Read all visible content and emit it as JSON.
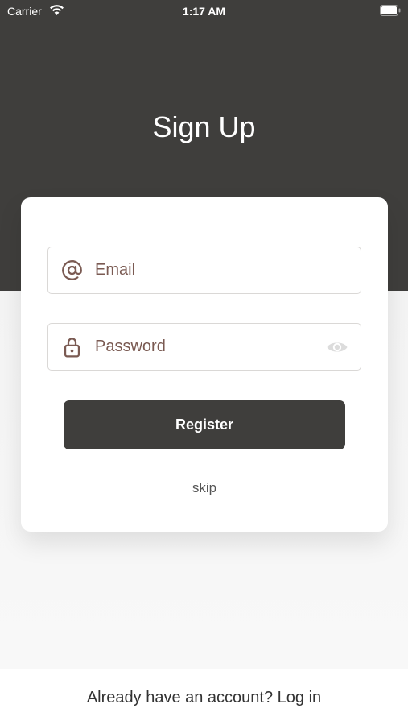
{
  "status_bar": {
    "carrier": "Carrier",
    "time": "1:17 AM",
    "wifi_icon": "wifi-icon",
    "battery_icon": "battery-icon"
  },
  "header": {
    "title": "Sign Up",
    "background_color": "#3f3e3c"
  },
  "form": {
    "email": {
      "placeholder": "Email",
      "value": "",
      "icon": "at-sign-icon"
    },
    "password": {
      "placeholder": "Password",
      "value": "",
      "icon": "lock-icon",
      "toggle_icon": "eye-icon"
    },
    "register_label": "Register",
    "skip_label": "skip"
  },
  "footer": {
    "prompt": "Already have an account? ",
    "login_label": "Log in"
  },
  "colors": {
    "accent": "#3f3e3c",
    "input_text": "#7a5a52"
  }
}
